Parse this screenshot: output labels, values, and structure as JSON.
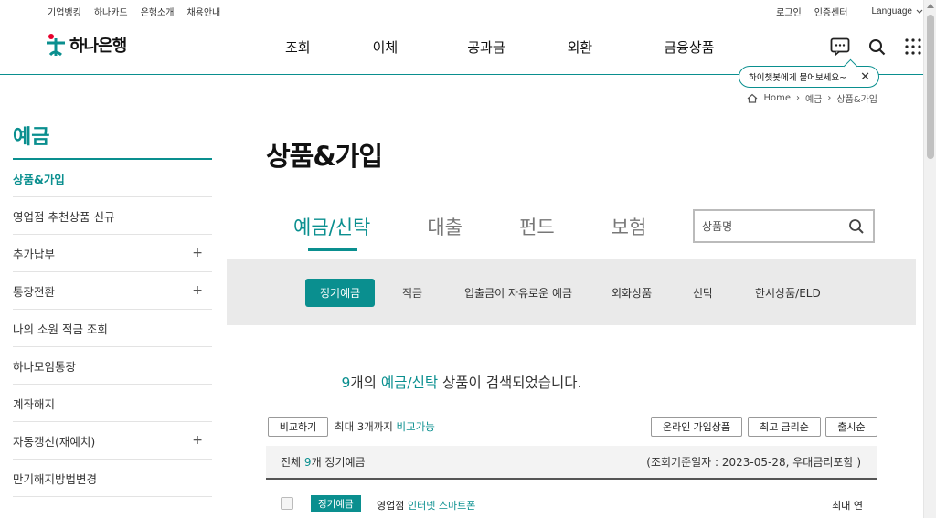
{
  "util": {
    "left_links": [
      "기업뱅킹",
      "하나카드",
      "은행소개",
      "채용안내"
    ],
    "login": "로그인",
    "cert": "인증센터",
    "language": "Language"
  },
  "header": {
    "logo_text": "하나은행",
    "nav": [
      "조회",
      "이체",
      "공과금",
      "외환",
      "금융상품"
    ],
    "chat_tip": "하이챗봇에게 물어보세요~"
  },
  "breadcrumb": [
    "Home",
    "예금",
    "상품&가입"
  ],
  "sidebar": {
    "title": "예금",
    "items": [
      {
        "label": "상품&가입",
        "plus": ""
      },
      {
        "label": "영업점 추천상품 신규",
        "plus": ""
      },
      {
        "label": "추가납부",
        "plus": "+"
      },
      {
        "label": "통장전환",
        "plus": "+"
      },
      {
        "label": "나의 소원 적금 조회",
        "plus": ""
      },
      {
        "label": "하나모임통장",
        "plus": ""
      },
      {
        "label": "계좌해지",
        "plus": ""
      },
      {
        "label": "자동갱신(재예치)",
        "plus": "+"
      },
      {
        "label": "만기해지방법변경",
        "plus": ""
      }
    ]
  },
  "main": {
    "title": "상품&가입",
    "tabs": [
      "예금/신탁",
      "대출",
      "펀드",
      "보험"
    ],
    "search_placeholder": "상품명",
    "subtabs": [
      "정기예금",
      "적금",
      "입출금이 자유로운 예금",
      "외화상품",
      "신탁",
      "한시상품/ELD"
    ],
    "result": {
      "count": "9",
      "count_suffix": "개의",
      "category": "예금/신탁",
      "suffix": "상품이 검색되었습니다."
    },
    "compare_button": "비교하기",
    "compare_note_prefix": "최대 3개까지",
    "compare_note_suffix": "비교가능",
    "sort_buttons": [
      "온라인 가입상품",
      "최고 금리순",
      "출시순"
    ],
    "list_header": {
      "prefix": "전체",
      "count": "9",
      "suffix": "개 정기예금",
      "date_note": "(조회기준일자 : 2023-05-28, 우대금리포함 )"
    },
    "row": {
      "badge": "정기예금",
      "channel_label": "영업점",
      "channels": "인터넷 스마트폰",
      "max_label": "최대 연"
    }
  },
  "colors": {
    "accent": "#0a8f8f",
    "brand_red": "#e8002d"
  }
}
